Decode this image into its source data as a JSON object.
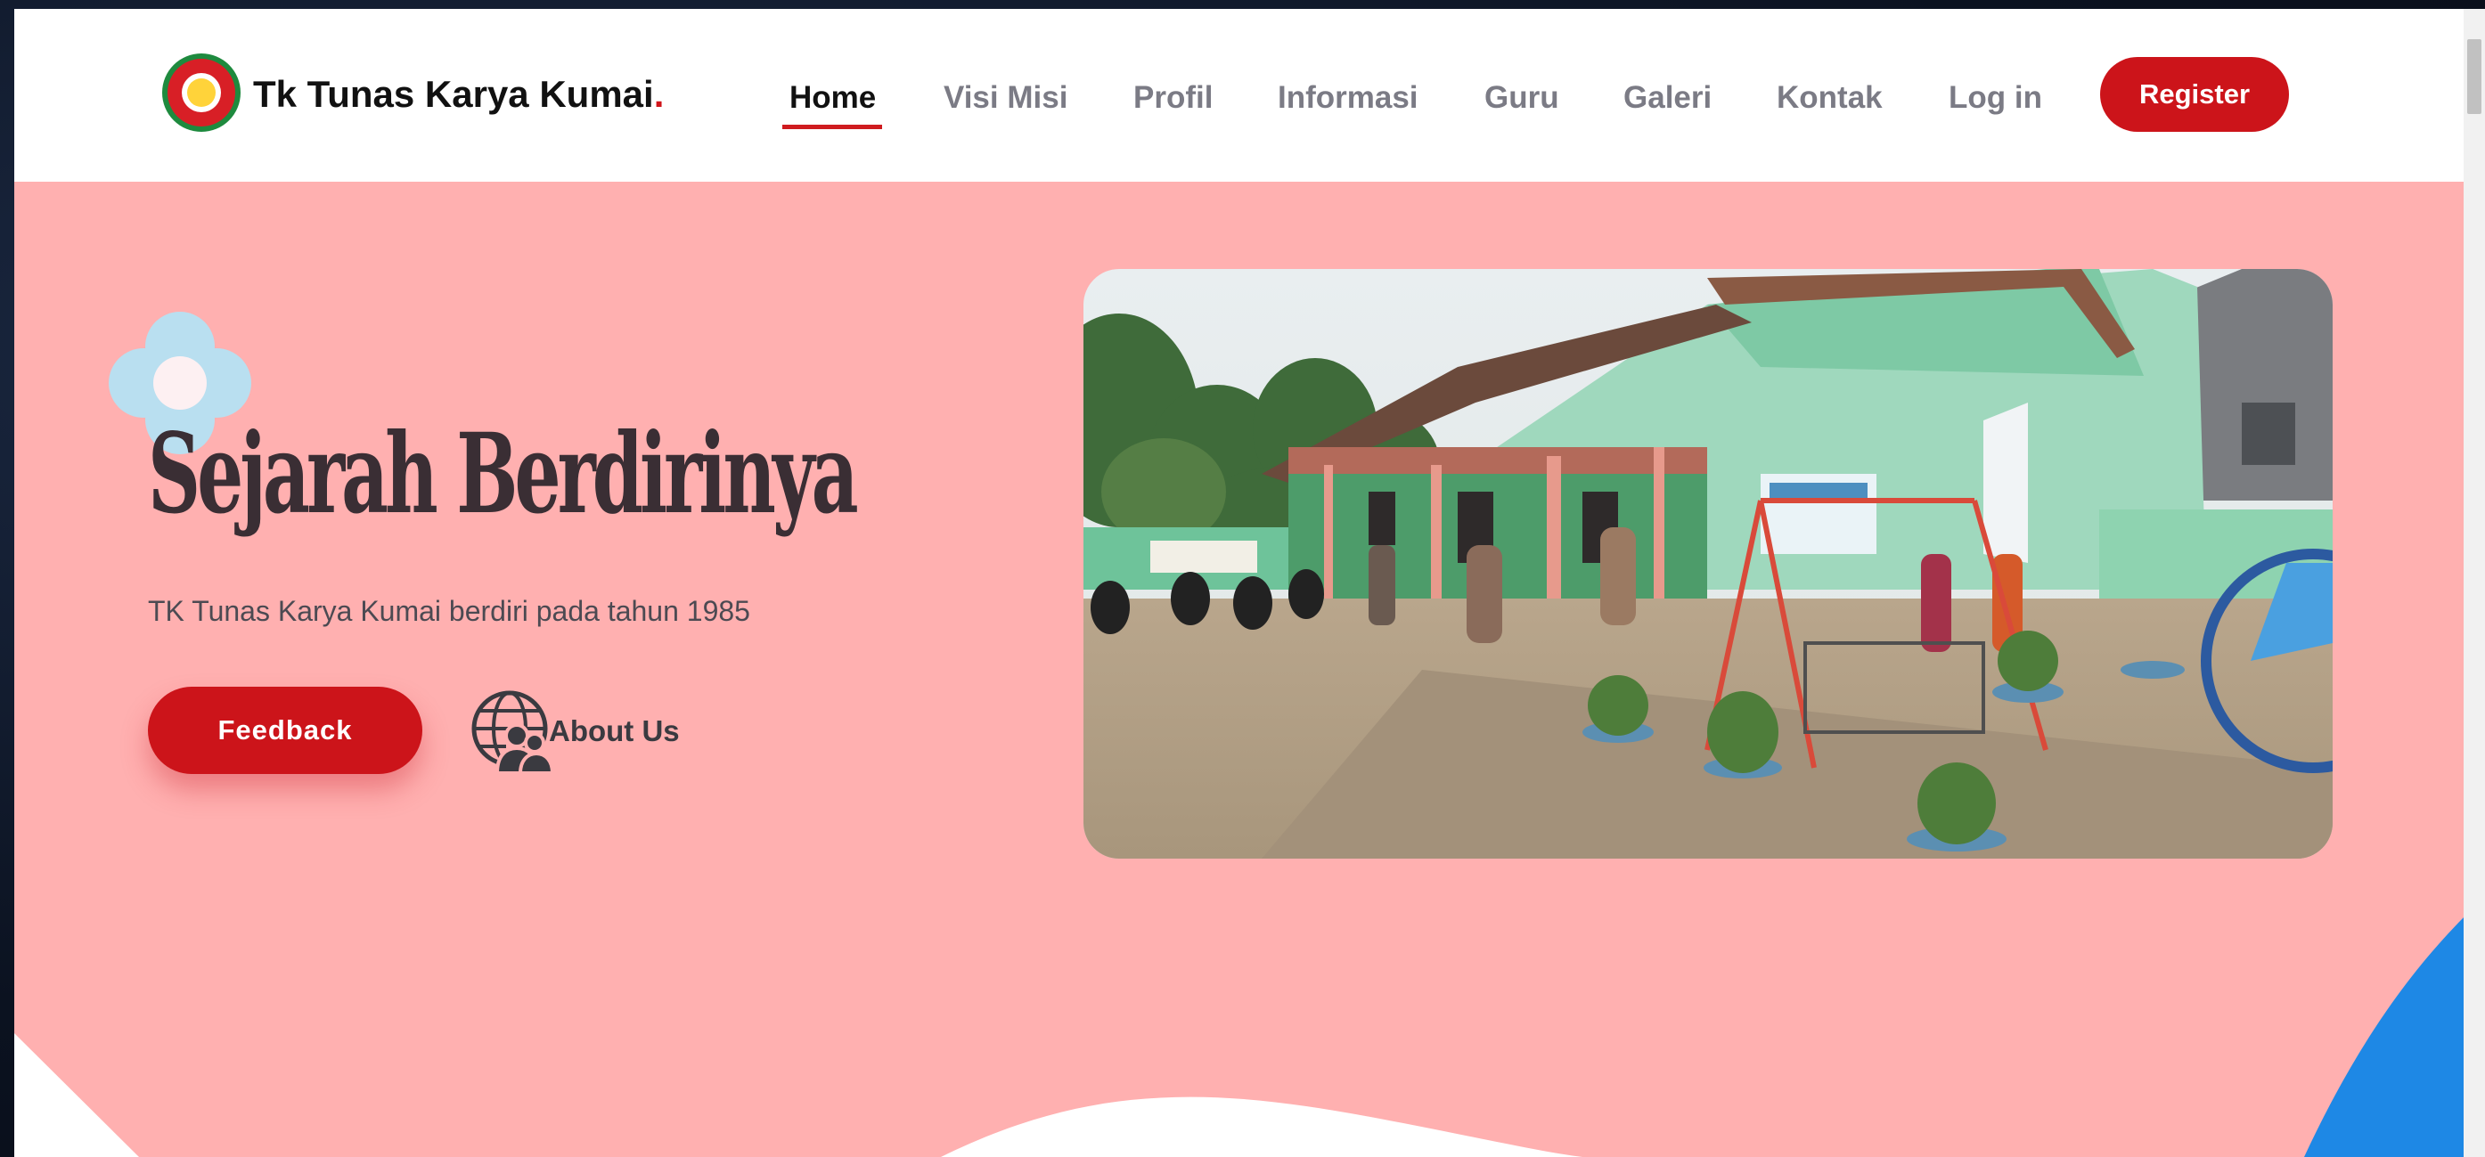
{
  "header": {
    "brand": "Tk Tunas Karya Kumai",
    "brand_dot": "."
  },
  "nav": {
    "items": [
      {
        "label": "Home",
        "active": true
      },
      {
        "label": "Visi Misi"
      },
      {
        "label": "Profil"
      },
      {
        "label": "Informasi"
      },
      {
        "label": "Guru"
      },
      {
        "label": "Galeri"
      },
      {
        "label": "Kontak"
      },
      {
        "label": "Log in"
      }
    ],
    "register_label": "Register"
  },
  "hero": {
    "title": "Sejarah Berdirinya",
    "subtitle": "TK Tunas Karya Kumai berdiri pada tahun 1985",
    "feedback_label": "Feedback",
    "about_label": "About Us"
  },
  "icons": {
    "logo": "school-logo-icon",
    "flower": "flower-decoration-icon",
    "about": "globe-people-icon"
  },
  "colors": {
    "accent": "#cc141a",
    "hero_bg": "#ffb0b0",
    "corner_blue": "#1e88e5",
    "flower": "#b9dff0"
  }
}
